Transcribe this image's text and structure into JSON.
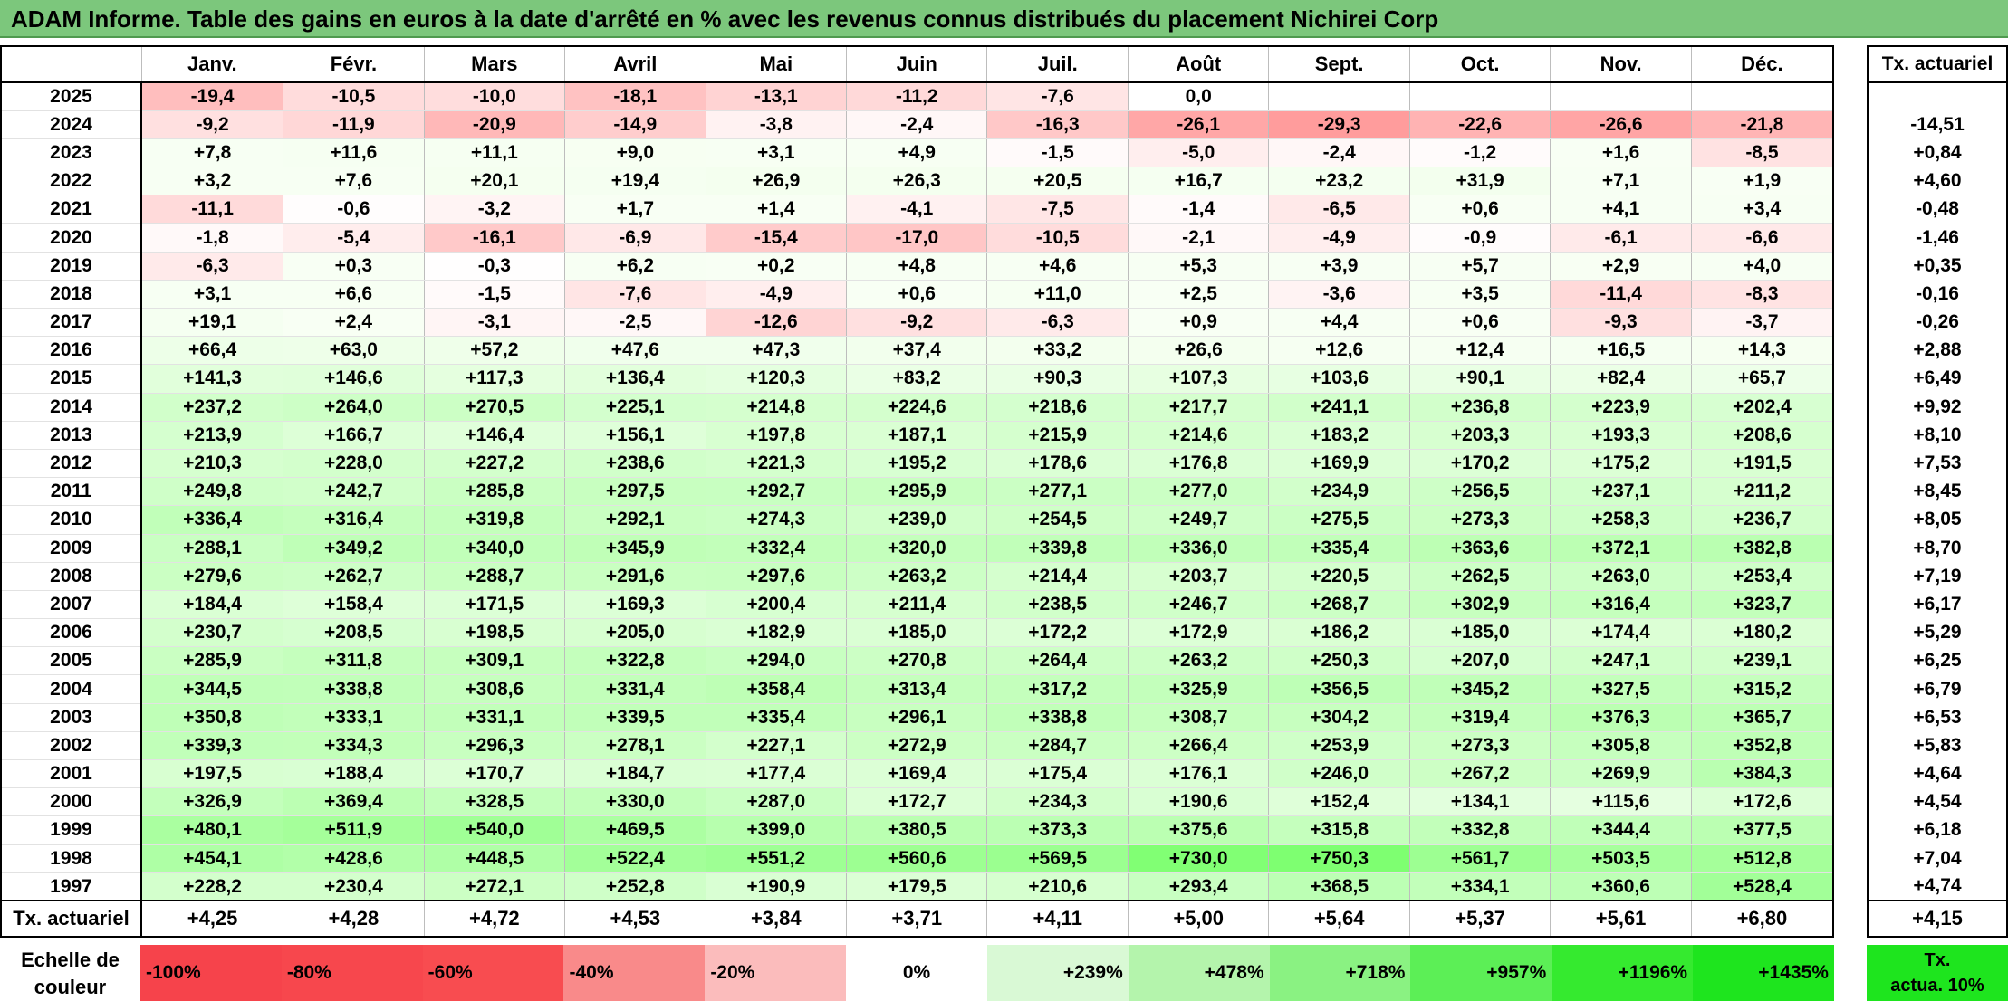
{
  "title": "ADAM Informe. Table des gains en euros à la date d'arrêté en % avec les revenus connus distribués du placement Nichirei Corp",
  "months": [
    "Janv.",
    "Févr.",
    "Mars",
    "Avril",
    "Mai",
    "Juin",
    "Juil.",
    "Août",
    "Sept.",
    "Oct.",
    "Nov.",
    "Déc."
  ],
  "tx_header": "Tx. actuariel",
  "rows": [
    {
      "year": "2025",
      "values": [
        "-19,4",
        "-10,5",
        "-10,0",
        "-18,1",
        "-13,1",
        "-11,2",
        "-7,6",
        "0,0",
        "",
        "",
        "",
        ""
      ],
      "tx": ""
    },
    {
      "year": "2024",
      "values": [
        "-9,2",
        "-11,9",
        "-20,9",
        "-14,9",
        "-3,8",
        "-2,4",
        "-16,3",
        "-26,1",
        "-29,3",
        "-22,6",
        "-26,6",
        "-21,8"
      ],
      "tx": "-14,51"
    },
    {
      "year": "2023",
      "values": [
        "+7,8",
        "+11,6",
        "+11,1",
        "+9,0",
        "+3,1",
        "+4,9",
        "-1,5",
        "-5,0",
        "-2,4",
        "-1,2",
        "+1,6",
        "-8,5"
      ],
      "tx": "+0,84"
    },
    {
      "year": "2022",
      "values": [
        "+3,2",
        "+7,6",
        "+20,1",
        "+19,4",
        "+26,9",
        "+26,3",
        "+20,5",
        "+16,7",
        "+23,2",
        "+31,9",
        "+7,1",
        "+1,9"
      ],
      "tx": "+4,60"
    },
    {
      "year": "2021",
      "values": [
        "-11,1",
        "-0,6",
        "-3,2",
        "+1,7",
        "+1,4",
        "-4,1",
        "-7,5",
        "-1,4",
        "-6,5",
        "+0,6",
        "+4,1",
        "+3,4"
      ],
      "tx": "-0,48"
    },
    {
      "year": "2020",
      "values": [
        "-1,8",
        "-5,4",
        "-16,1",
        "-6,9",
        "-15,4",
        "-17,0",
        "-10,5",
        "-2,1",
        "-4,9",
        "-0,9",
        "-6,1",
        "-6,6"
      ],
      "tx": "-1,46"
    },
    {
      "year": "2019",
      "values": [
        "-6,3",
        "+0,3",
        "-0,3",
        "+6,2",
        "+0,2",
        "+4,8",
        "+4,6",
        "+5,3",
        "+3,9",
        "+5,7",
        "+2,9",
        "+4,0"
      ],
      "tx": "+0,35"
    },
    {
      "year": "2018",
      "values": [
        "+3,1",
        "+6,6",
        "-1,5",
        "-7,6",
        "-4,9",
        "+0,6",
        "+11,0",
        "+2,5",
        "-3,6",
        "+3,5",
        "-11,4",
        "-8,3"
      ],
      "tx": "-0,16"
    },
    {
      "year": "2017",
      "values": [
        "+19,1",
        "+2,4",
        "-3,1",
        "-2,5",
        "-12,6",
        "-9,2",
        "-6,3",
        "+0,9",
        "+4,4",
        "+0,6",
        "-9,3",
        "-3,7"
      ],
      "tx": "-0,26"
    },
    {
      "year": "2016",
      "values": [
        "+66,4",
        "+63,0",
        "+57,2",
        "+47,6",
        "+47,3",
        "+37,4",
        "+33,2",
        "+26,6",
        "+12,6",
        "+12,4",
        "+16,5",
        "+14,3"
      ],
      "tx": "+2,88"
    },
    {
      "year": "2015",
      "values": [
        "+141,3",
        "+146,6",
        "+117,3",
        "+136,4",
        "+120,3",
        "+83,2",
        "+90,3",
        "+107,3",
        "+103,6",
        "+90,1",
        "+82,4",
        "+65,7"
      ],
      "tx": "+6,49"
    },
    {
      "year": "2014",
      "values": [
        "+237,2",
        "+264,0",
        "+270,5",
        "+225,1",
        "+214,8",
        "+224,6",
        "+218,6",
        "+217,7",
        "+241,1",
        "+236,8",
        "+223,9",
        "+202,4"
      ],
      "tx": "+9,92"
    },
    {
      "year": "2013",
      "values": [
        "+213,9",
        "+166,7",
        "+146,4",
        "+156,1",
        "+197,8",
        "+187,1",
        "+215,9",
        "+214,6",
        "+183,2",
        "+203,3",
        "+193,3",
        "+208,6"
      ],
      "tx": "+8,10"
    },
    {
      "year": "2012",
      "values": [
        "+210,3",
        "+228,0",
        "+227,2",
        "+238,6",
        "+221,3",
        "+195,2",
        "+178,6",
        "+176,8",
        "+169,9",
        "+170,2",
        "+175,2",
        "+191,5"
      ],
      "tx": "+7,53"
    },
    {
      "year": "2011",
      "values": [
        "+249,8",
        "+242,7",
        "+285,8",
        "+297,5",
        "+292,7",
        "+295,9",
        "+277,1",
        "+277,0",
        "+234,9",
        "+256,5",
        "+237,1",
        "+211,2"
      ],
      "tx": "+8,45"
    },
    {
      "year": "2010",
      "values": [
        "+336,4",
        "+316,4",
        "+319,8",
        "+292,1",
        "+274,3",
        "+239,0",
        "+254,5",
        "+249,7",
        "+275,5",
        "+273,3",
        "+258,3",
        "+236,7"
      ],
      "tx": "+8,05"
    },
    {
      "year": "2009",
      "values": [
        "+288,1",
        "+349,2",
        "+340,0",
        "+345,9",
        "+332,4",
        "+320,0",
        "+339,8",
        "+336,0",
        "+335,4",
        "+363,6",
        "+372,1",
        "+382,8"
      ],
      "tx": "+8,70"
    },
    {
      "year": "2008",
      "values": [
        "+279,6",
        "+262,7",
        "+288,7",
        "+291,6",
        "+297,6",
        "+263,2",
        "+214,4",
        "+203,7",
        "+220,5",
        "+262,5",
        "+263,0",
        "+253,4"
      ],
      "tx": "+7,19"
    },
    {
      "year": "2007",
      "values": [
        "+184,4",
        "+158,4",
        "+171,5",
        "+169,3",
        "+200,4",
        "+211,4",
        "+238,5",
        "+246,7",
        "+268,7",
        "+302,9",
        "+316,4",
        "+323,7"
      ],
      "tx": "+6,17"
    },
    {
      "year": "2006",
      "values": [
        "+230,7",
        "+208,5",
        "+198,5",
        "+205,0",
        "+182,9",
        "+185,0",
        "+172,2",
        "+172,9",
        "+186,2",
        "+185,0",
        "+174,4",
        "+180,2"
      ],
      "tx": "+5,29"
    },
    {
      "year": "2005",
      "values": [
        "+285,9",
        "+311,8",
        "+309,1",
        "+322,8",
        "+294,0",
        "+270,8",
        "+264,4",
        "+263,2",
        "+250,3",
        "+207,0",
        "+247,1",
        "+239,1"
      ],
      "tx": "+6,25"
    },
    {
      "year": "2004",
      "values": [
        "+344,5",
        "+338,8",
        "+308,6",
        "+331,4",
        "+358,4",
        "+313,4",
        "+317,2",
        "+325,9",
        "+356,5",
        "+345,2",
        "+327,5",
        "+315,2"
      ],
      "tx": "+6,79"
    },
    {
      "year": "2003",
      "values": [
        "+350,8",
        "+333,1",
        "+331,1",
        "+339,5",
        "+335,4",
        "+296,1",
        "+338,8",
        "+308,7",
        "+304,2",
        "+319,4",
        "+376,3",
        "+365,7"
      ],
      "tx": "+6,53"
    },
    {
      "year": "2002",
      "values": [
        "+339,3",
        "+334,3",
        "+296,3",
        "+278,1",
        "+227,1",
        "+272,9",
        "+284,7",
        "+266,4",
        "+253,9",
        "+273,3",
        "+305,8",
        "+352,8"
      ],
      "tx": "+5,83"
    },
    {
      "year": "2001",
      "values": [
        "+197,5",
        "+188,4",
        "+170,7",
        "+184,7",
        "+177,4",
        "+169,4",
        "+175,4",
        "+176,1",
        "+246,0",
        "+267,2",
        "+269,9",
        "+384,3"
      ],
      "tx": "+4,64"
    },
    {
      "year": "2000",
      "values": [
        "+326,9",
        "+369,4",
        "+328,5",
        "+330,0",
        "+287,0",
        "+172,7",
        "+234,3",
        "+190,6",
        "+152,4",
        "+134,1",
        "+115,6",
        "+172,6"
      ],
      "tx": "+4,54"
    },
    {
      "year": "1999",
      "values": [
        "+480,1",
        "+511,9",
        "+540,0",
        "+469,5",
        "+399,0",
        "+380,5",
        "+373,3",
        "+375,6",
        "+315,8",
        "+332,8",
        "+344,4",
        "+377,5"
      ],
      "tx": "+6,18"
    },
    {
      "year": "1998",
      "values": [
        "+454,1",
        "+428,6",
        "+448,5",
        "+522,4",
        "+551,2",
        "+560,6",
        "+569,5",
        "+730,0",
        "+750,3",
        "+561,7",
        "+503,5",
        "+512,8"
      ],
      "tx": "+7,04"
    },
    {
      "year": "1997",
      "values": [
        "+228,2",
        "+230,4",
        "+272,1",
        "+252,8",
        "+190,9",
        "+179,5",
        "+210,6",
        "+293,4",
        "+368,5",
        "+334,1",
        "+360,6",
        "+528,4"
      ],
      "tx": "+4,74"
    }
  ],
  "avg_row": {
    "label": "Tx. actuariel",
    "values": [
      "+4,25",
      "+4,28",
      "+4,72",
      "+4,53",
      "+3,84",
      "+3,71",
      "+4,11",
      "+5,00",
      "+5,64",
      "+5,37",
      "+5,61",
      "+6,80"
    ],
    "tx": "+4,15"
  },
  "scale": {
    "label_line1": "Echelle de",
    "label_line2": "couleur",
    "steps": [
      {
        "label": "-100%",
        "color": "#f6434b"
      },
      {
        "label": "-80%",
        "color": "#f7474d"
      },
      {
        "label": "-60%",
        "color": "#f84c50"
      },
      {
        "label": "-40%",
        "color": "#f98a8a"
      },
      {
        "label": "-20%",
        "color": "#fbbcbc"
      },
      {
        "label": "0%",
        "color": "#ffffff"
      },
      {
        "label": "+239%",
        "color": "#d9f9d5"
      },
      {
        "label": "+478%",
        "color": "#b4f4ac"
      },
      {
        "label": "+718%",
        "color": "#8af282"
      },
      {
        "label": "+957%",
        "color": "#5cef56"
      },
      {
        "label": "+1196%",
        "color": "#35ea2f"
      },
      {
        "label": "+1435%",
        "color": "#1ee51e"
      }
    ],
    "tx_line1": "Tx.",
    "tx_line2": "actua. 10%",
    "tx_color": "#1ee51e"
  },
  "colors": {
    "title_bg": "#7cc77c",
    "negative_full": "#f6434b",
    "positive_full": "#1ee51e"
  }
}
